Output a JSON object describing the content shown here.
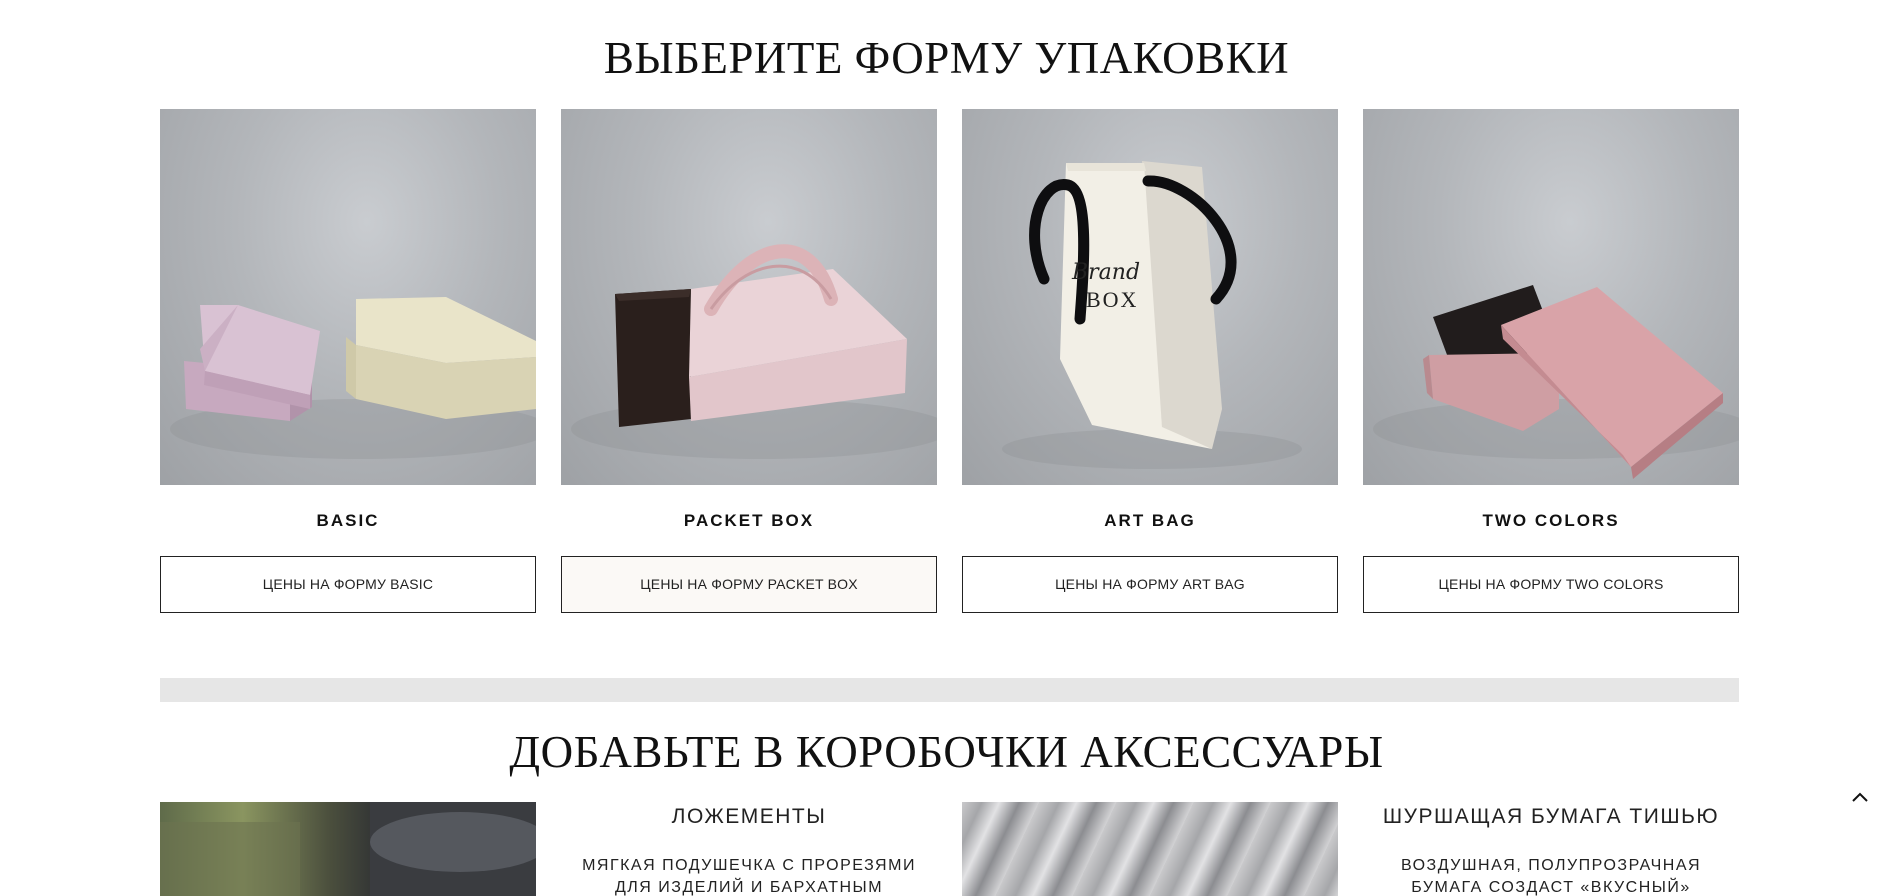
{
  "sections": {
    "shapes_title": "ВЫБЕРИТЕ ФОРМУ УПАКОВКИ",
    "accessories_title": "ДОБАВЬТЕ В КОРОБОЧКИ АКСЕССУАРЫ"
  },
  "cards": [
    {
      "name": "BASIC",
      "button": "ЦЕНЫ НА ФОРМУ BASIC"
    },
    {
      "name": "PACKET BOX",
      "button": "ЦЕНЫ НА ФОРМУ PACKET BOX"
    },
    {
      "name": "ART BAG",
      "button": "ЦЕНЫ НА ФОРМУ ART BAG"
    },
    {
      "name": "TWO COLORS",
      "button": "ЦЕНЫ НА ФОРМУ TWO COLORS"
    }
  ],
  "accessories": [
    {
      "title": "ЛОЖЕМЕНТЫ",
      "description": "МЯГКАЯ ПОДУШЕЧКА С ПРОРЕЗЯМИ\nДЛЯ ИЗДЕЛИЙ И БАРХАТНЫМ"
    },
    {
      "title": "ШУРШАЩАЯ БУМАГА ТИШЬЮ",
      "description": "ВОЗДУШНАЯ, ПОЛУПРОЗРАЧНАЯ\nБУМАГА СОЗДАСТ  «ВКУСНЫЙ»"
    }
  ],
  "bag_logo": {
    "script": "Brand",
    "letters": "BOX"
  },
  "icons": {
    "scroll_top": "chevron-up-icon"
  },
  "colors": {
    "photo_bg": "#b3b6ba",
    "button_border": "#222222",
    "divider": "#e6e6e6"
  }
}
